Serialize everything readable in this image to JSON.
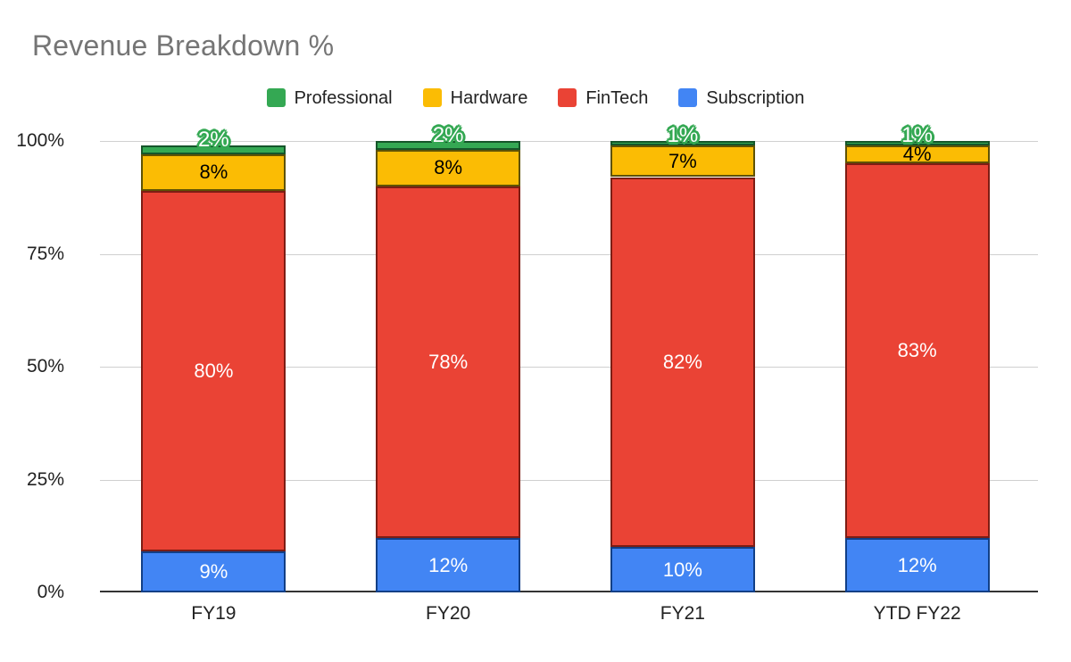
{
  "chart_data": {
    "type": "bar",
    "stacked": true,
    "stack_mode": "percent",
    "title": "Revenue Breakdown %",
    "xlabel": "",
    "ylabel": "",
    "categories": [
      "FY19",
      "FY20",
      "FY21",
      "YTD FY22"
    ],
    "ylim": [
      0,
      100
    ],
    "yticks": [
      "0%",
      "25%",
      "50%",
      "75%",
      "100%"
    ],
    "ytick_values": [
      0,
      25,
      50,
      75,
      100
    ],
    "grid": true,
    "legend_position": "top",
    "series": [
      {
        "name": "Professional",
        "color": "#34a853",
        "values": [
          2,
          2,
          1,
          1
        ],
        "labels": [
          "2%",
          "2%",
          "1%",
          "1%"
        ],
        "label_color": "#ffffff",
        "label_style": "outlined-cap"
      },
      {
        "name": "Hardware",
        "color": "#fbbc04",
        "values": [
          8,
          8,
          7,
          4
        ],
        "labels": [
          "8%",
          "8%",
          "7%",
          "4%"
        ],
        "label_color": "#000000",
        "label_style": "inside"
      },
      {
        "name": "FinTech",
        "color": "#ea4335",
        "values": [
          80,
          78,
          82,
          83
        ],
        "labels": [
          "80%",
          "78%",
          "82%",
          "83%"
        ],
        "label_color": "#ffffff",
        "label_style": "inside"
      },
      {
        "name": "Subscription",
        "color": "#4285f4",
        "values": [
          9,
          12,
          10,
          12
        ],
        "labels": [
          "9%",
          "12%",
          "10%",
          "12%"
        ],
        "label_color": "#ffffff",
        "label_style": "inside"
      }
    ]
  },
  "title": {
    "text": "Revenue Breakdown %"
  },
  "legend": {
    "items": [
      {
        "label": "Professional",
        "color": "#34a853"
      },
      {
        "label": "Hardware",
        "color": "#fbbc04"
      },
      {
        "label": "FinTech",
        "color": "#ea4335"
      },
      {
        "label": "Subscription",
        "color": "#4285f4"
      }
    ]
  },
  "axes": {
    "y_ticks": [
      "100%",
      "75%",
      "50%",
      "25%",
      "0%"
    ],
    "x_ticks": [
      "FY19",
      "FY20",
      "FY21",
      "YTD FY22"
    ]
  },
  "bar_labels": {
    "fy19": {
      "professional": "2%",
      "hardware": "8%",
      "fintech": "80%",
      "subscription": "9%"
    },
    "fy20": {
      "professional": "2%",
      "hardware": "8%",
      "fintech": "78%",
      "subscription": "12%"
    },
    "fy21": {
      "professional": "1%",
      "hardware": "7%",
      "fintech": "82%",
      "subscription": "10%"
    },
    "ytd_fy22": {
      "professional": "1%",
      "hardware": "4%",
      "fintech": "83%",
      "subscription": "12%"
    }
  }
}
